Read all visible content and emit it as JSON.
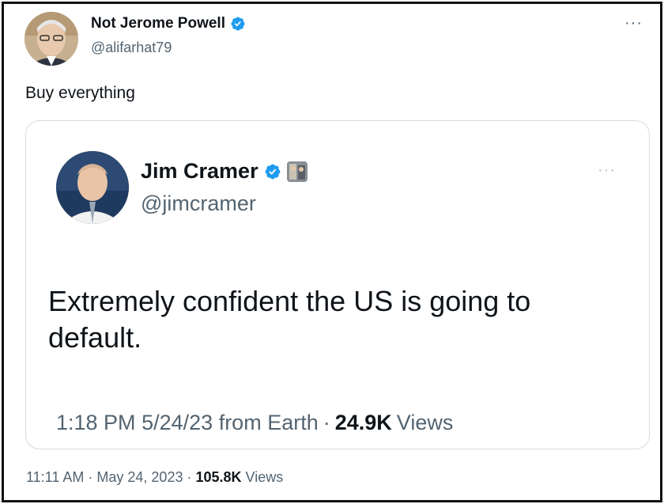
{
  "outer_tweet": {
    "author_name": "Not Jerome Powell",
    "author_handle": "@alifarhat79",
    "text": "Buy everything",
    "meta": {
      "time": "11:11 AM",
      "date": "May 24, 2023",
      "views_count": "105.8K",
      "views_label": "Views"
    },
    "more_label": "···"
  },
  "quoted_tweet": {
    "author_name": "Jim Cramer",
    "author_handle": "@jimcramer",
    "text": "Extremely confident the US is going to default.",
    "meta": {
      "time": "1:18 PM",
      "date": "5/24/23",
      "location": "from Earth",
      "views_count": "24.9K",
      "views_label": "Views"
    },
    "more_label": "···"
  },
  "colors": {
    "verified_blue": "#1d9bf0",
    "text_primary": "#0f1419",
    "text_secondary": "#536471",
    "card_border": "#d6dbdf"
  },
  "icons": [
    "verified-badge-icon",
    "affiliate-badge-icon",
    "more-options-icon"
  ]
}
